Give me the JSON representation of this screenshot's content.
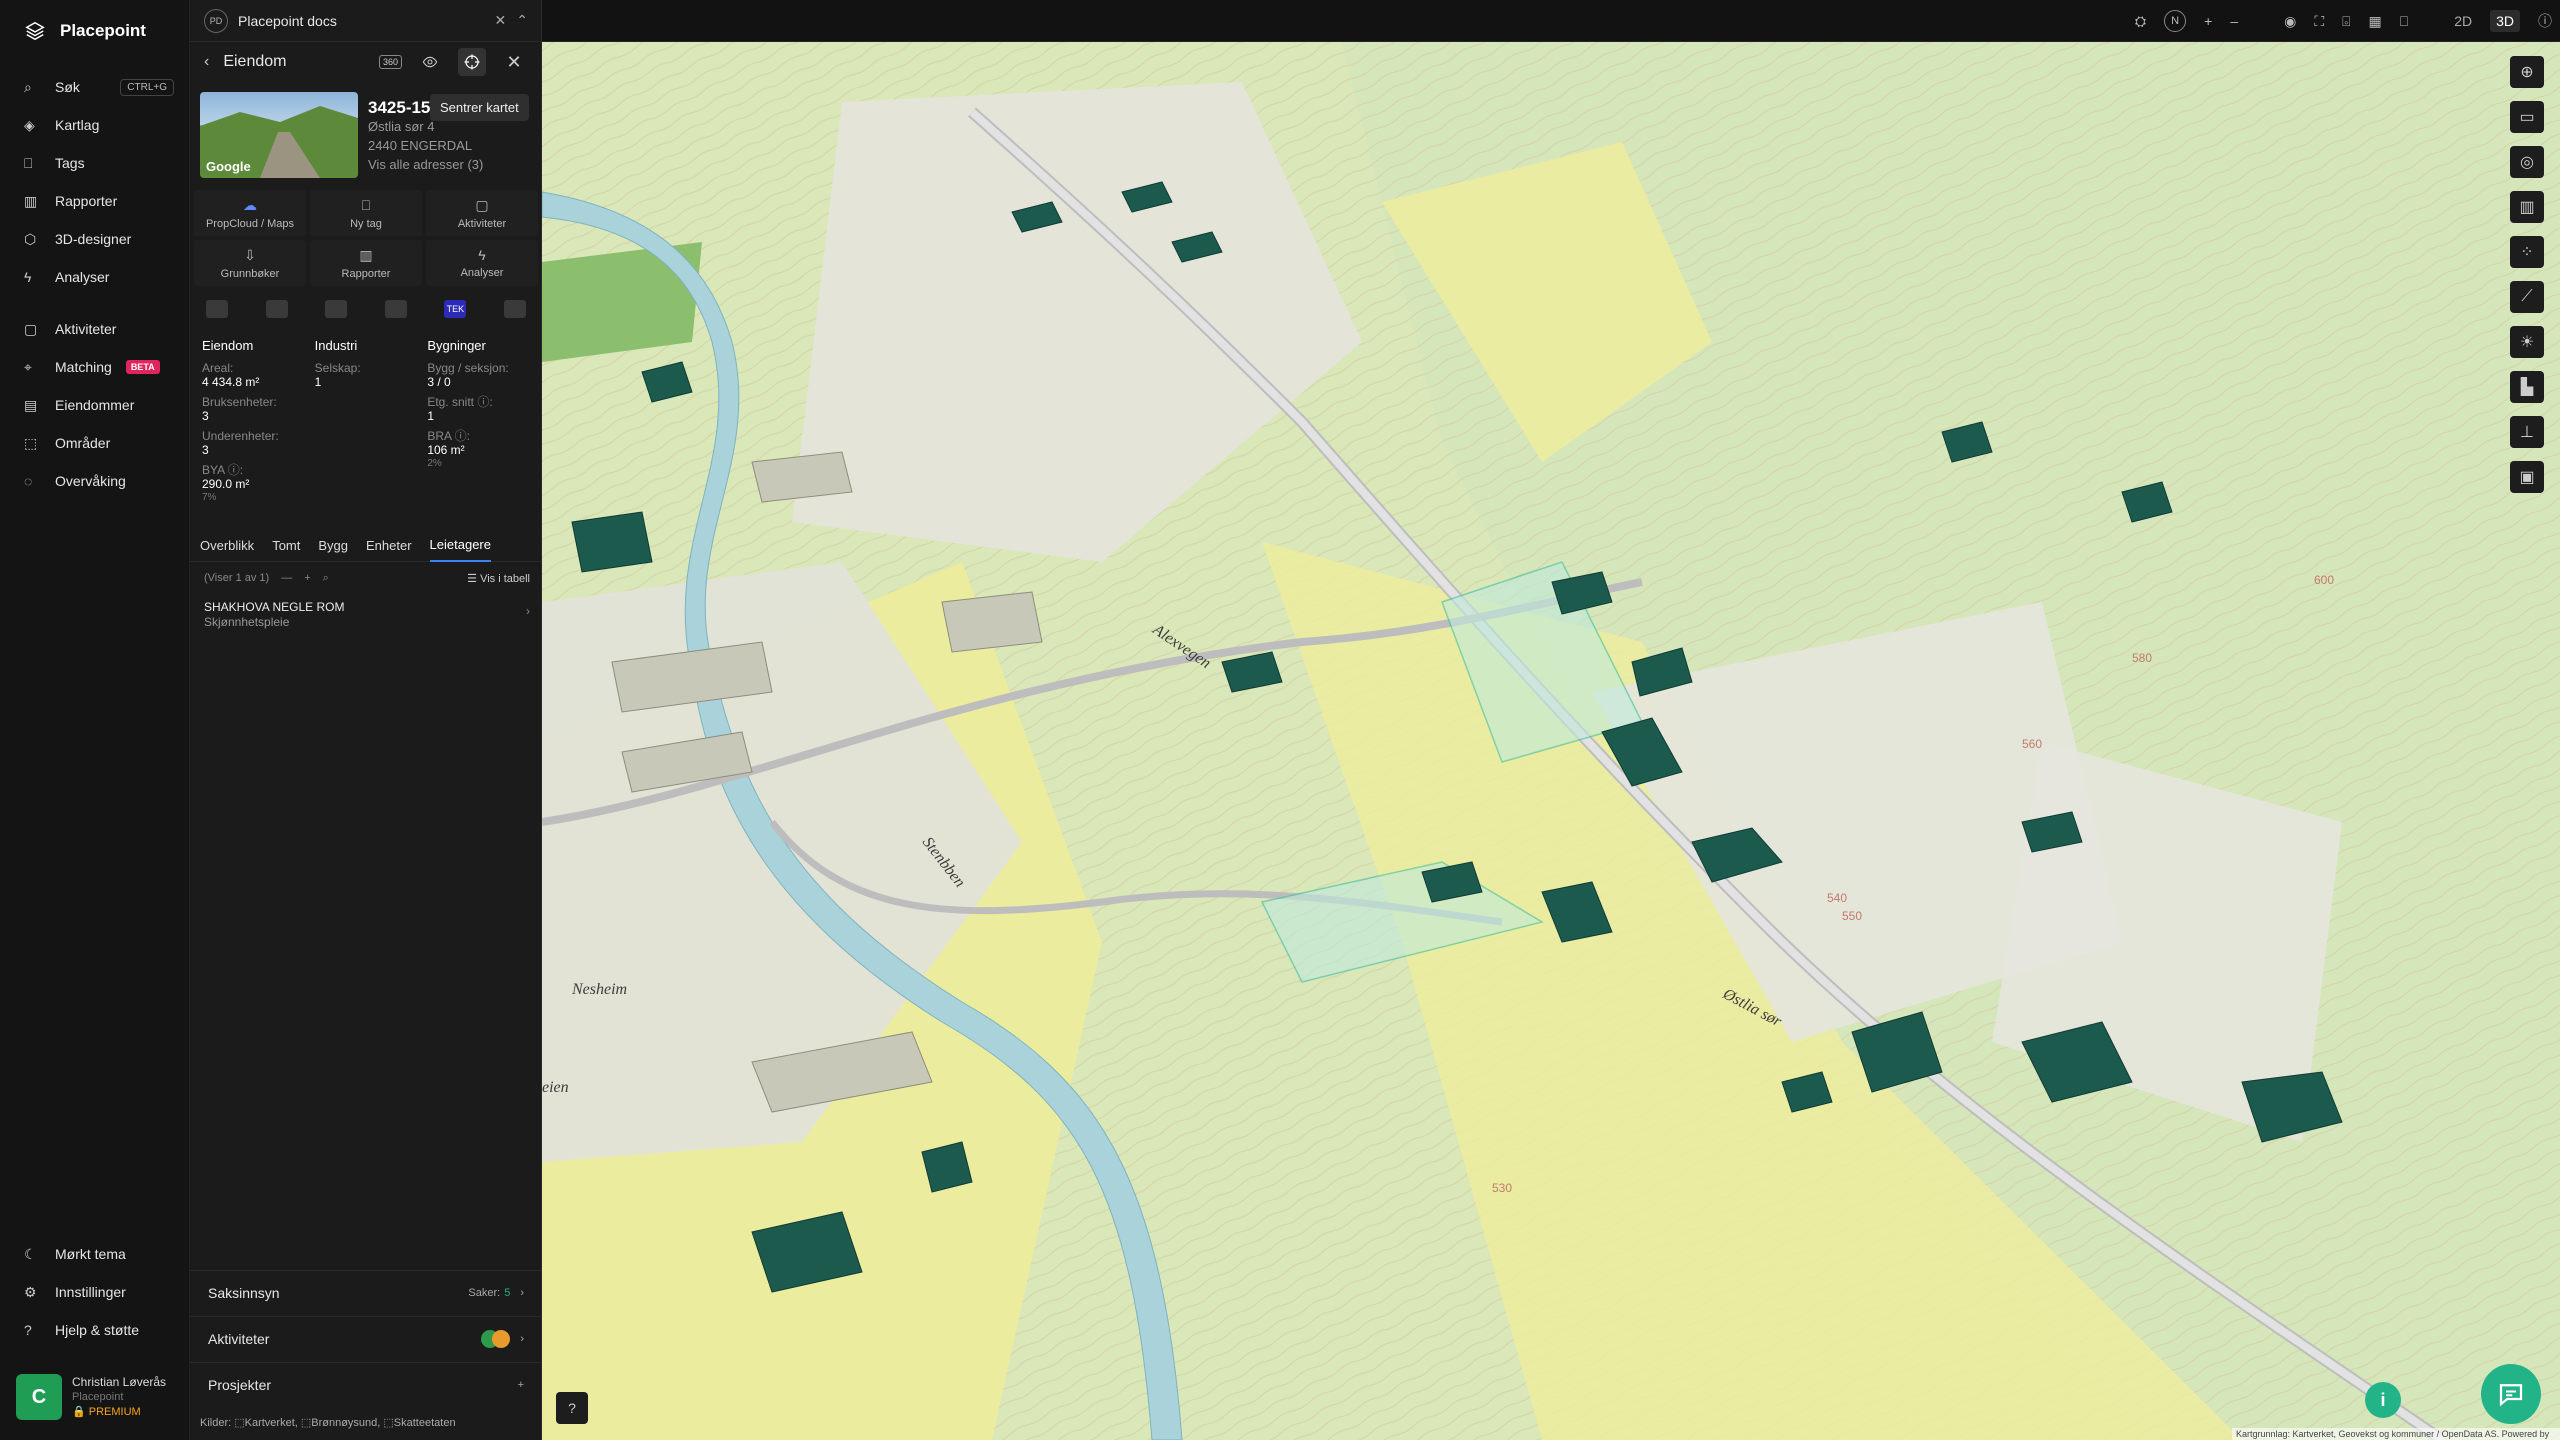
{
  "app": {
    "name": "Placepoint"
  },
  "sidebar": {
    "items": [
      {
        "label": "Søk",
        "shortcut": "CTRL+G",
        "icon": "search-icon"
      },
      {
        "label": "Kartlag",
        "icon": "layers-icon"
      },
      {
        "label": "Tags",
        "icon": "bookmark-icon"
      },
      {
        "label": "Rapporter",
        "icon": "chart-icon"
      },
      {
        "label": "3D-designer",
        "icon": "cube-icon"
      },
      {
        "label": "Analyser",
        "icon": "bolt-icon"
      },
      {
        "label": "Aktiviteter",
        "icon": "message-icon"
      },
      {
        "label": "Matching",
        "badge": "BETA",
        "icon": "match-icon"
      },
      {
        "label": "Eiendommer",
        "icon": "building-icon"
      },
      {
        "label": "Områder",
        "icon": "area-icon"
      },
      {
        "label": "Overvåking",
        "icon": "check-circle-icon"
      }
    ],
    "bottom": [
      {
        "label": "Mørkt tema",
        "icon": "moon-icon"
      },
      {
        "label": "Innstillinger",
        "icon": "gear-icon"
      },
      {
        "label": "Hjelp & støtte",
        "icon": "help-icon"
      }
    ],
    "user": {
      "initial": "C",
      "name": "Christian Løverås",
      "org": "Placepoint",
      "plan": "PREMIUM"
    }
  },
  "doc": {
    "badge": "PD",
    "title": "Placepoint docs"
  },
  "panel": {
    "title": "Eiendom",
    "tooltip": "Sentrer kartet",
    "badge": "360",
    "thumb_label": "Google",
    "property": {
      "id": "3425-15",
      "street": "Østlia sør 4",
      "postal": "2440 ENGERDAL",
      "all_addresses": "Vis alle adresser (3)"
    },
    "actions": [
      {
        "label": "PropCloud / Maps",
        "icon": "cloud-icon"
      },
      {
        "label": "Ny tag",
        "icon": "bookmark-icon"
      },
      {
        "label": "Aktiviteter",
        "icon": "message-icon"
      },
      {
        "label": "Grunnbøker",
        "icon": "download-icon"
      },
      {
        "label": "Rapporter",
        "icon": "chart-icon"
      },
      {
        "label": "Analyser",
        "icon": "bolt-icon"
      }
    ],
    "source_logos": [
      "logo-1",
      "logo-2",
      "logo-3",
      "logo-4",
      "TEK",
      "logo-6"
    ],
    "columns": [
      {
        "title": "Eiendom",
        "rows": [
          {
            "label": "Areal:",
            "value": "4 434.8 m²"
          },
          {
            "label": "Bruksenheter:",
            "value": "3"
          },
          {
            "label": "Underenheter:",
            "value": "3"
          },
          {
            "label": "BYA ⓘ:",
            "value": "290.0 m²",
            "sub": "7%"
          }
        ]
      },
      {
        "title": "Industri",
        "rows": [
          {
            "label": "Selskap:",
            "value": "1"
          }
        ]
      },
      {
        "title": "Bygninger",
        "rows": [
          {
            "label": "Bygg / seksjon:",
            "value": "3 / 0"
          },
          {
            "label": "Etg. snitt ⓘ:",
            "value": "1"
          },
          {
            "label": "BRA ⓘ:",
            "value": "106 m²",
            "sub": "2%"
          }
        ]
      }
    ],
    "tabs": [
      "Overblikk",
      "Tomt",
      "Bygg",
      "Enheter",
      "Leietagere"
    ],
    "active_tab": "Leietagere",
    "list": {
      "showing": "(Viser 1 av 1)",
      "view_table": "Vis i tabell"
    },
    "tenant": {
      "name": "SHAKHOVA NEGLE ROM",
      "type": "Skjønnhetspleie"
    },
    "accordions": [
      {
        "label": "Saksinnsyn",
        "meta_label": "Saker:",
        "meta_value": "5"
      },
      {
        "label": "Aktiviteter"
      },
      {
        "label": "Prosjekter"
      }
    ],
    "sources": "Kilder: ⬚Kartverket, ⬚Brønnøysund, ⬚Skatteetaten"
  },
  "topbar": {
    "north": "N",
    "mode_2d": "2D",
    "mode_3d": "3D"
  },
  "map": {
    "labels": [
      "Nesheim",
      "Østlia sør",
      "Stenbben",
      "eien",
      "Alexvegen"
    ],
    "contours": [
      "600",
      "580",
      "560",
      "540",
      "550",
      "530"
    ],
    "attribution": "Kartgrunnlag: Kartverket, Geovekst og kommuner / OpenData AS. Powered by Esri",
    "info_icon": "i"
  },
  "colors": {
    "accent": "#3b82f6",
    "chat": "#23b388",
    "building": "#1d5a4e",
    "water": "#a9d2da",
    "field": "#ecec9e"
  }
}
